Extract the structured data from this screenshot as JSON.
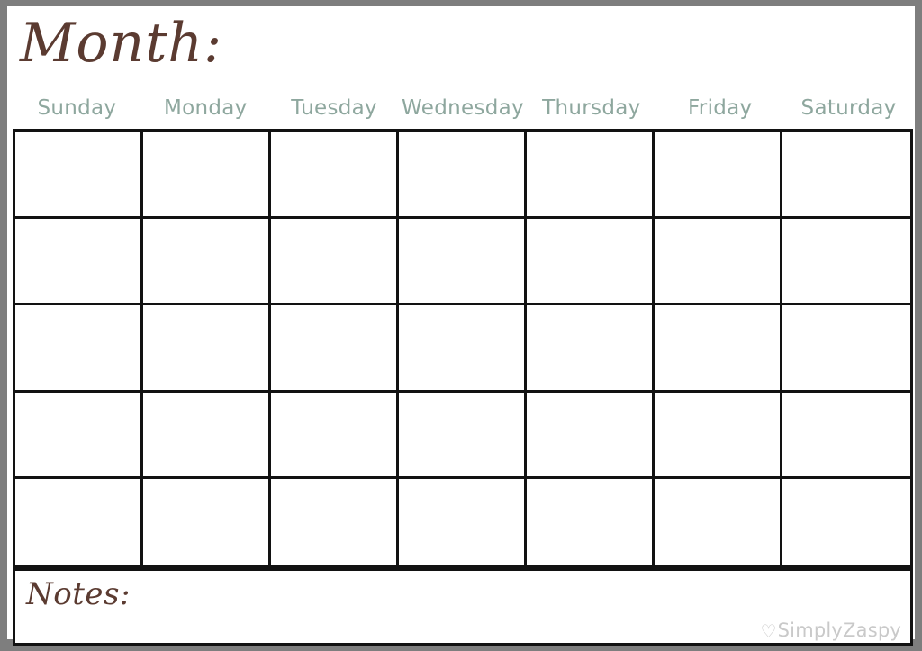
{
  "page": {
    "title_label": "Month:",
    "frame_color": "#7e7e7e",
    "sheet_color": "#ffffff",
    "script_color": "#5b3b31",
    "weekday_color": "#8ea79e",
    "grid_line_color": "#121212",
    "watermark_color": "#c9c9c9"
  },
  "weekdays": [
    {
      "label": "Sunday"
    },
    {
      "label": "Monday"
    },
    {
      "label": "Tuesday"
    },
    {
      "label": "Wednesday"
    },
    {
      "label": "Thursday"
    },
    {
      "label": "Friday"
    },
    {
      "label": "Saturday"
    }
  ],
  "calendar": {
    "rows": 5,
    "columns": 7,
    "cells": [
      {
        "value": ""
      },
      {
        "value": ""
      },
      {
        "value": ""
      },
      {
        "value": ""
      },
      {
        "value": ""
      },
      {
        "value": ""
      },
      {
        "value": ""
      },
      {
        "value": ""
      },
      {
        "value": ""
      },
      {
        "value": ""
      },
      {
        "value": ""
      },
      {
        "value": ""
      },
      {
        "value": ""
      },
      {
        "value": ""
      },
      {
        "value": ""
      },
      {
        "value": ""
      },
      {
        "value": ""
      },
      {
        "value": ""
      },
      {
        "value": ""
      },
      {
        "value": ""
      },
      {
        "value": ""
      },
      {
        "value": ""
      },
      {
        "value": ""
      },
      {
        "value": ""
      },
      {
        "value": ""
      },
      {
        "value": ""
      },
      {
        "value": ""
      },
      {
        "value": ""
      },
      {
        "value": ""
      },
      {
        "value": ""
      },
      {
        "value": ""
      },
      {
        "value": ""
      },
      {
        "value": ""
      },
      {
        "value": ""
      },
      {
        "value": ""
      }
    ]
  },
  "notes": {
    "label": "Notes:",
    "value": ""
  },
  "watermark": {
    "heart_glyph": "♡",
    "brand": "SimplyZaspy"
  }
}
